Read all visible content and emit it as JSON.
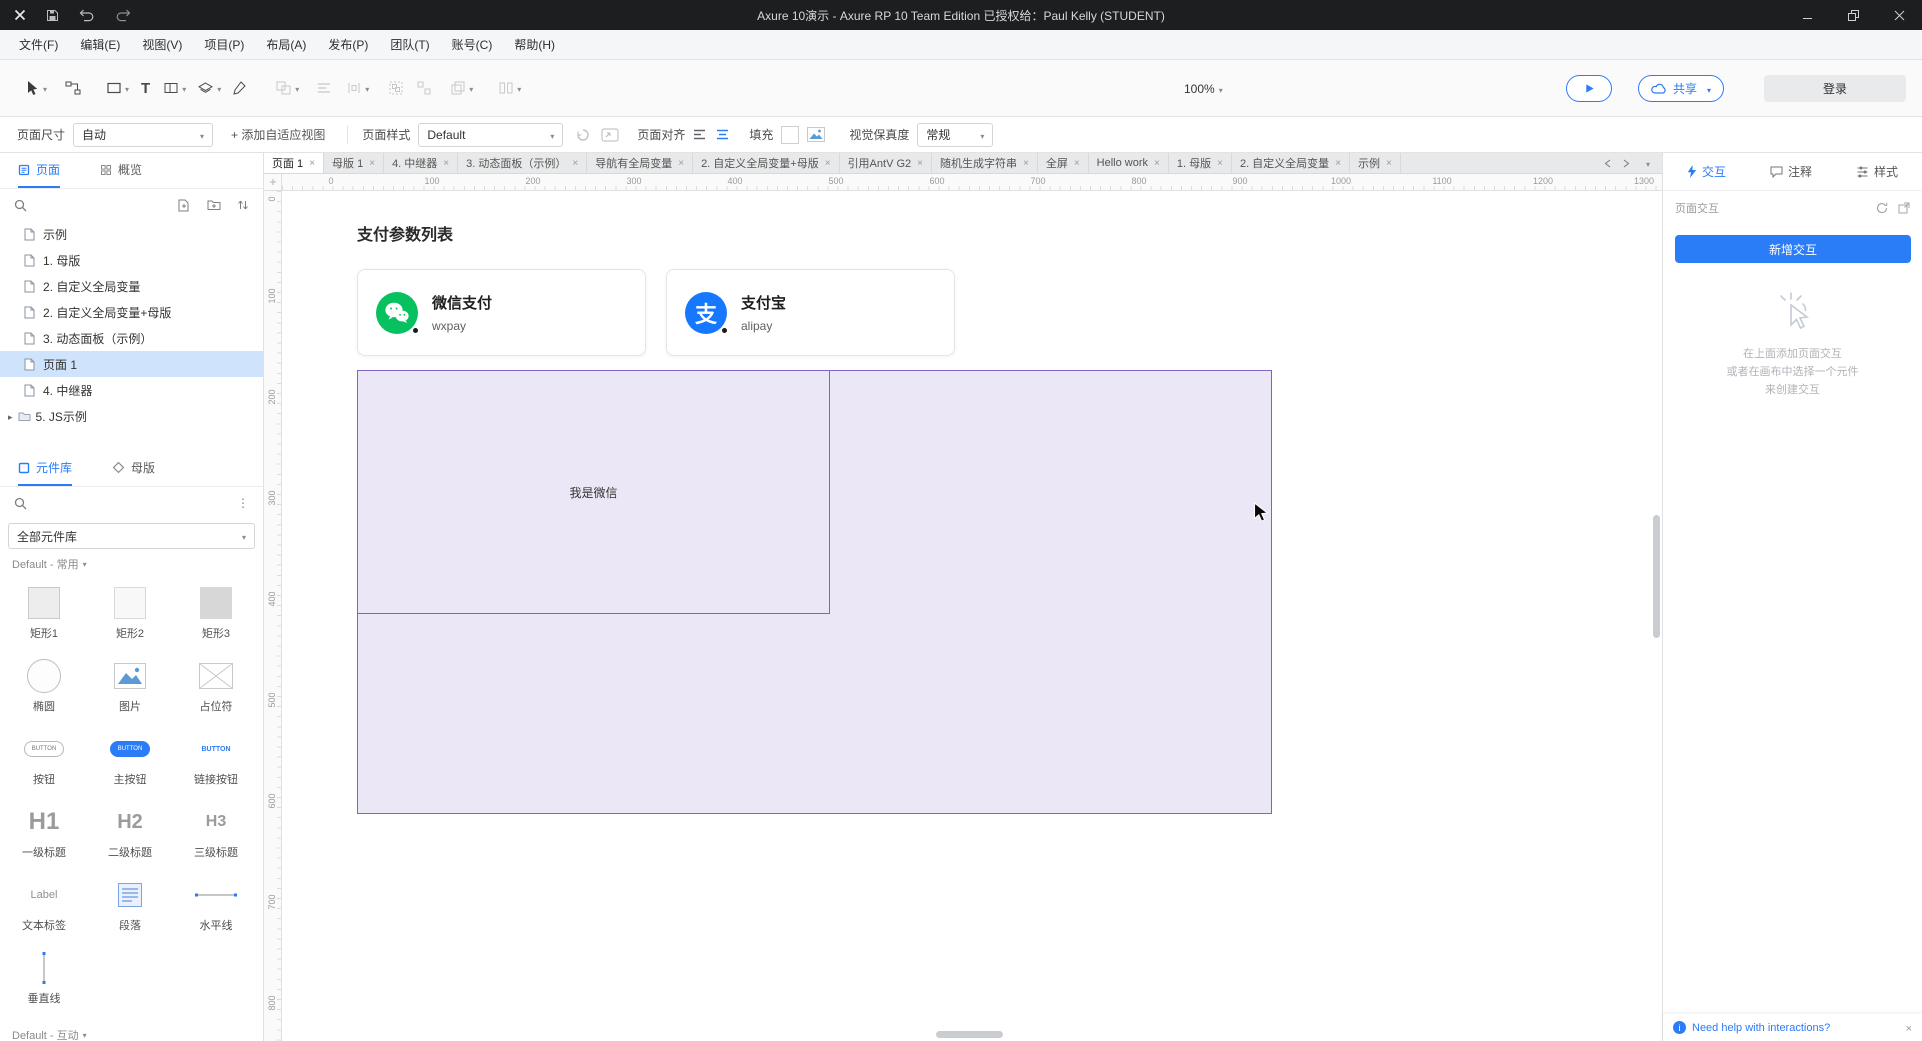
{
  "colors": {
    "accent": "#2a7cf7",
    "wechat_green": "#07c160",
    "alipay_blue": "#1677ff",
    "repeater_fill": "#ece7f7",
    "repeater_border": "#8064c5",
    "titlebar_bg": "#1d1e20",
    "selected_row": "#cfe4fc"
  },
  "glyphs": {
    "t": "T",
    "h1": "H1",
    "h2": "H2",
    "h3": "H3",
    "label": "Label",
    "button": "BUTTON",
    "alipay": "支"
  },
  "titlebar": {
    "title": "Axure 10演示 - Axure RP 10 Team Edition 已授权给：Paul Kelly (STUDENT)"
  },
  "menubar": {
    "file": "文件(F)",
    "edit": "编辑(E)",
    "view": "视图(V)",
    "project": "项目(P)",
    "layout": "布局(A)",
    "publish": "发布(P)",
    "team": "团队(T)",
    "account": "账号(C)",
    "help": "帮助(H)"
  },
  "toolbar": {
    "zoom": "100%",
    "share": "共享",
    "login": "登录"
  },
  "pagebar": {
    "page_size_label": "页面尺寸",
    "page_size_value": "自动",
    "add_adaptive_view": "+ 添加自适应视图",
    "page_style_label": "页面样式",
    "page_style_value": "Default",
    "page_align_label": "页面对齐",
    "fill_label": "填充",
    "fidelity_label": "视觉保真度",
    "fidelity_value": "常规"
  },
  "sidebar": {
    "pages_tab": "页面",
    "overview_tab": "概览",
    "tree": {
      "item0": "示例",
      "item1": "1. 母版",
      "item2": "2. 自定义全局变量",
      "item3": "2. 自定义全局变量+母版",
      "item4": "3. 动态面板（示例）",
      "item5": "页面 1",
      "item6": "4. 中继器",
      "item7": "5. JS示例"
    },
    "widgets_tab": "元件库",
    "masters_tab": "母版",
    "library_select": "全部元件库",
    "section_label": "Default - 常用",
    "widgets": {
      "w0": "矩形1",
      "w1": "矩形2",
      "w2": "矩形3",
      "w3": "椭圆",
      "w4": "图片",
      "w5": "占位符",
      "w6": "按钮",
      "w7": "主按钮",
      "w8": "链接按钮",
      "w9": "一级标题",
      "w10": "二级标题",
      "w11": "三级标题",
      "w12": "文本标签",
      "w13": "段落",
      "w14": "水平线",
      "w15": "垂直线"
    },
    "footer": "Default - 互动"
  },
  "tabstrip": {
    "t0": "页面 1",
    "t1": "母版 1",
    "t2": "4. 中继器",
    "t3": "3. 动态面板（示例）",
    "t4": "导航有全局变量",
    "t5": "2. 自定义全局变量+母版",
    "t6": "引用AntV G2",
    "t7": "随机生成字符串",
    "t8": "全屏",
    "t9": "Hello work",
    "t10": "1. 母版",
    "t11": "2. 自定义全局变量",
    "t12": "示例"
  },
  "ruler": {
    "h0": "0",
    "h1": "100",
    "h2": "200",
    "h3": "300",
    "h4": "400",
    "h5": "500",
    "h6": "600",
    "h7": "700",
    "h8": "800",
    "h9": "900",
    "h10": "1000",
    "h11": "1100",
    "h12": "1200",
    "h13": "1300",
    "v0": "0",
    "v1": "100",
    "v2": "200",
    "v3": "300",
    "v4": "400",
    "v5": "500",
    "v6": "600",
    "v7": "700",
    "v8": "800"
  },
  "canvas": {
    "title": "支付参数列表",
    "card1_name": "微信支付",
    "card1_code": "wxpay",
    "card2_name": "支付宝",
    "card2_code": "alipay",
    "repeater_text": "我是微信"
  },
  "rightpanel": {
    "tab_interactions": "交互",
    "tab_notes": "注释",
    "tab_style": "样式",
    "section_label": "页面交互",
    "new_interaction": "新增交互",
    "hint1": "在上面添加页面交互",
    "hint2": "或者在画布中选择一个元件",
    "hint3": "来创建交互",
    "help": "Need help with interactions?"
  }
}
